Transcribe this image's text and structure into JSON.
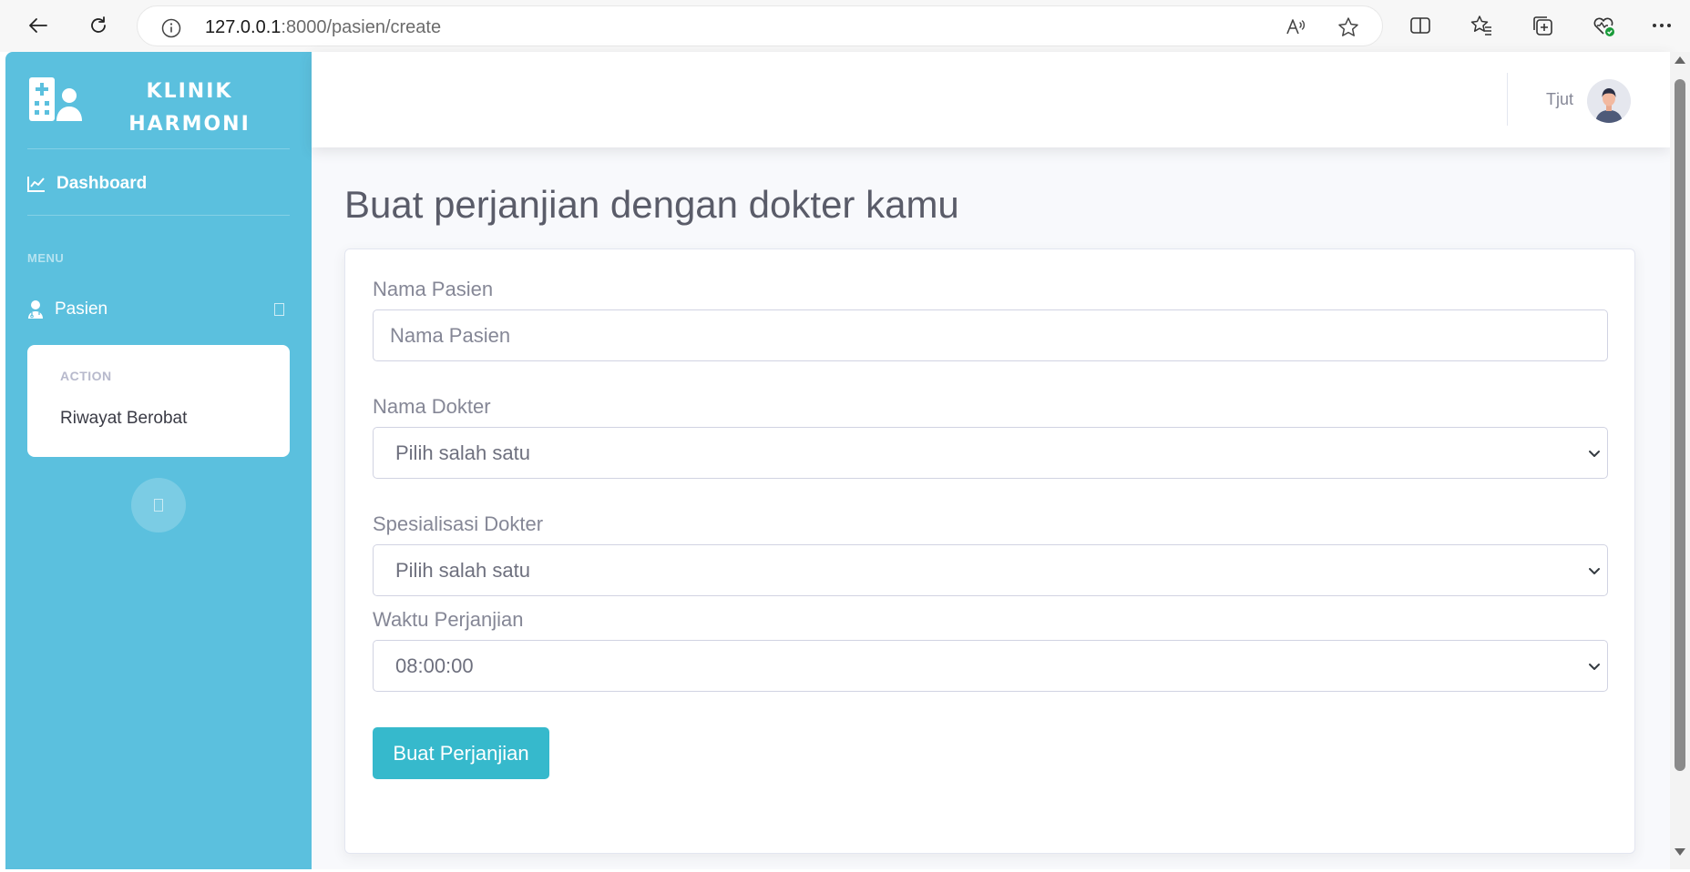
{
  "browser": {
    "url_host": "127.0.0.1",
    "url_path": ":8000/pasien/create"
  },
  "sidebar": {
    "brand_line1": "KLINIK",
    "brand_line2": "HARMONI",
    "dashboard_label": "Dashboard",
    "menu_heading": "MENU",
    "pasien_label": "Pasien",
    "collapse": {
      "header": "ACTION",
      "item_label": "Riwayat Berobat"
    }
  },
  "topbar": {
    "user_name": "Tjut"
  },
  "page": {
    "title": "Buat perjanjian dengan dokter kamu"
  },
  "form": {
    "nama_pasien_label": "Nama Pasien",
    "nama_pasien_placeholder": "Nama Pasien",
    "nama_dokter_label": "Nama Dokter",
    "nama_dokter_value": "Pilih salah satu",
    "spesialisasi_label": "Spesialisasi Dokter",
    "spesialisasi_value": "Pilih salah satu",
    "waktu_label": "Waktu Perjanjian",
    "waktu_value": "08:00:00",
    "submit_label": "Buat Perjanjian"
  },
  "colors": {
    "sidebar_bg": "#5bc0de",
    "button_bg": "#36b9cc",
    "heading_text": "#5a5c69",
    "muted_text": "#858796"
  },
  "icons": {
    "back": "back-arrow-icon",
    "refresh": "refresh-icon",
    "info": "info-icon",
    "read_aloud": "read-aloud-icon",
    "favorite": "star-icon",
    "split": "split-screen-icon",
    "favorites": "favorites-icon",
    "collections": "collections-icon",
    "health": "browser-essentials-icon",
    "more": "more-icon",
    "brand": "clinic-logo-icon",
    "dashboard": "chart-line-icon",
    "pasien": "user-doctor-icon"
  }
}
